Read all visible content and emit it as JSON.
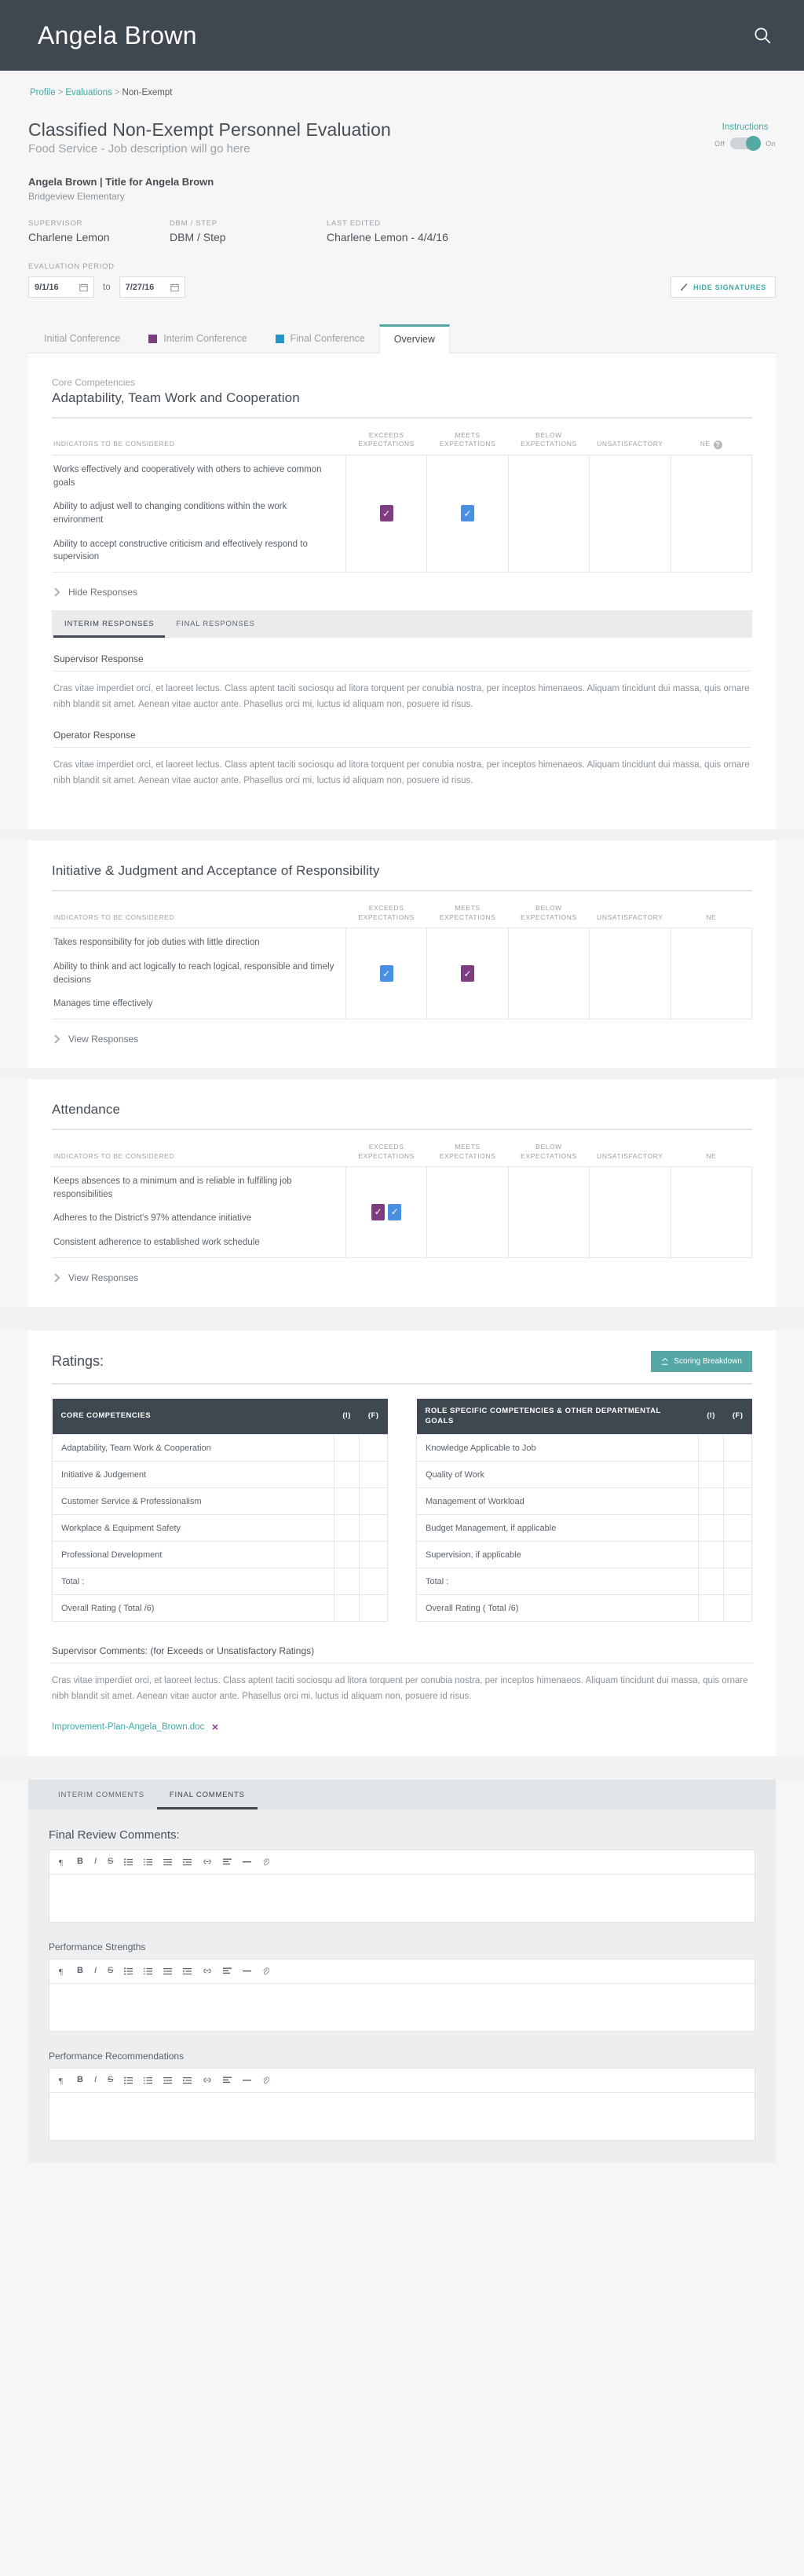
{
  "topbar": {
    "title": "Angela Brown",
    "search_icon": "search-icon"
  },
  "breadcrumb": {
    "profile": "Profile",
    "evaluations": "Evaluations",
    "current": "Non-Exempt",
    "sep": ">"
  },
  "header": {
    "title": "Classified Non-Exempt Personnel Evaluation",
    "subtitle": "Food Service - Job description will go here",
    "instructions_label": "Instructions",
    "toggle_off": "Off",
    "toggle_on": "On",
    "toggle_state": "on"
  },
  "employee": {
    "name_title": "Angela Brown | Title for Angela Brown",
    "school": "Bridgeview Elementary"
  },
  "meta": [
    {
      "label": "SUPERVISOR",
      "value": "Charlene Lemon"
    },
    {
      "label": "DBM / STEP",
      "value": "DBM / Step"
    },
    {
      "label": "LAST EDITED",
      "value": "Charlene Lemon - 4/4/16"
    }
  ],
  "period": {
    "label": "EVALUATION PERIOD",
    "start": "9/1/16",
    "end": "7/27/16",
    "to": "to",
    "hide_signatures": "HIDE SIGNATURES"
  },
  "conference_tabs": [
    {
      "label": "Initial Conference",
      "marker": "none",
      "active": false
    },
    {
      "label": "Interim Conference",
      "marker": "#7d3d80",
      "active": false
    },
    {
      "label": "Final Conference",
      "marker": "#2196c9",
      "active": false
    },
    {
      "label": "Overview",
      "marker": "none",
      "active": true
    }
  ],
  "table_headers": {
    "indicators": "INDICATORS TO BE CONSIDERED",
    "exceeds": "EXCEEDS EXPECTATIONS",
    "meets": "MEETS EXPECTATIONS",
    "below": "BELOW EXPECTATIONS",
    "unsatisfactory": "UNSATISFACTORY",
    "ne": "NE"
  },
  "sections": [
    {
      "kicker": "Core Competencies",
      "title": "Adaptability, Team Work and Cooperation",
      "has_help_icon": true,
      "indicators": [
        "Works effectively and cooperatively with others to achieve common goals",
        "Ability to adjust well to changing conditions within the work environment",
        "Ability to accept constructive criticism and effectively respond to supervision"
      ],
      "marks": {
        "exceeds": [
          "purple"
        ],
        "meets": [
          "blue"
        ],
        "below": [],
        "unsatisfactory": [],
        "ne": []
      },
      "responses_toggle": "Hide Responses",
      "responses_expanded": true,
      "response_tabs": [
        {
          "label": "INTERIM RESPONSES",
          "active": true
        },
        {
          "label": "FINAL RESPONSES",
          "active": false
        }
      ],
      "responses": [
        {
          "heading": "Supervisor Response",
          "text": "Cras vitae imperdiet orci, et laoreet lectus. Class aptent taciti sociosqu ad litora torquent per conubia nostra, per inceptos himenaeos. Aliquam tincidunt dui massa, quis ornare nibh blandit sit amet. Aenean vitae auctor ante. Phasellus orci mi, luctus id aliquam non, posuere id risus."
        },
        {
          "heading": "Operator Response",
          "text": "Cras vitae imperdiet orci, et laoreet lectus. Class aptent taciti sociosqu ad litora torquent per conubia nostra, per inceptos himenaeos. Aliquam tincidunt dui massa, quis ornare nibh blandit sit amet. Aenean vitae auctor ante. Phasellus orci mi, luctus id aliquam non, posuere id risus."
        }
      ]
    },
    {
      "kicker": "",
      "title": "Initiative & Judgment  and Acceptance of Responsibility",
      "has_help_icon": false,
      "indicators": [
        "Takes responsibility for job duties with little direction",
        "Ability to think and act logically to reach logical, responsible and timely decisions",
        "Manages time effectively"
      ],
      "marks": {
        "exceeds": [
          "blue"
        ],
        "meets": [
          "purple"
        ],
        "below": [],
        "unsatisfactory": [],
        "ne": []
      },
      "responses_toggle": "View Responses",
      "responses_expanded": false,
      "response_tabs": [],
      "responses": []
    },
    {
      "kicker": "",
      "title": "Attendance",
      "has_help_icon": false,
      "indicators": [
        "Keeps absences to a minimum and is reliable in fulfilling job responsibilities",
        "Adheres to the District's 97% attendance initiative",
        "Consistent adherence to established work schedule"
      ],
      "marks": {
        "exceeds": [
          "purple",
          "blue"
        ],
        "meets": [],
        "below": [],
        "unsatisfactory": [],
        "ne": []
      },
      "responses_toggle": "View Responses",
      "responses_expanded": false,
      "response_tabs": [],
      "responses": []
    }
  ],
  "ratings": {
    "title": "Ratings:",
    "scoring_button": "Scoring Breakdown",
    "col_i": "(I)",
    "col_f": "(F)",
    "left_table": {
      "header": "CORE COMPETENCIES",
      "rows": [
        "Adaptability, Team Work & Cooperation",
        "Initiative & Judgement",
        "Customer Service & Professionalism",
        "Workplace & Equipment Safety",
        "Professional Development",
        "Total :",
        "Overall  Rating ( Total /6)"
      ]
    },
    "right_table": {
      "header": "ROLE SPECIFIC COMPETENCIES & OTHER DEPARTMENTAL GOALS",
      "rows": [
        "Knowledge Applicable to Job",
        "Quality of Work",
        "Management of Workload",
        "Budget Management, if applicable",
        "Supervision, if applicable",
        "Total :",
        "Overall  Rating ( Total /6)"
      ]
    },
    "supervisor_comments_title": "Supervisor Comments: (for Exceeds or Unsatisfactory Ratings)",
    "supervisor_comments_text": "Cras vitae imperdiet orci, et laoreet lectus. Class aptent taciti sociosqu ad litora torquent per conubia nostra, per inceptos himenaeos. Aliquam tincidunt dui massa, quis ornare nibh blandit sit amet. Aenean vitae auctor ante. Phasellus orci mi, luctus id aliquam non, posuere id risus.",
    "attachment": "Improvement-Plan-Angela_Brown.doc",
    "attachment_remove": "✕"
  },
  "comments_panel": {
    "tabs": [
      {
        "label": "INTERIM COMMENTS",
        "active": false
      },
      {
        "label": "FINAL COMMENTS",
        "active": true
      }
    ],
    "final_review_title": "Final Review Comments:",
    "performance_strengths_title": "Performance Strengths",
    "performance_recommendations_title": "Performance Recommendations",
    "toolbar_icons": [
      "paragraph-icon",
      "bold-icon",
      "italic-icon",
      "strikethrough-icon",
      "bullet-list-icon",
      "numbered-list-icon",
      "outdent-icon",
      "indent-icon",
      "link-icon",
      "align-icon",
      "horizontal-rule-icon",
      "attachment-icon"
    ],
    "toolbar_glyphs": [
      "¶",
      "B",
      "I",
      "S",
      "☰",
      "☷",
      "⇤",
      "⇥",
      "∞",
      "≡",
      "—",
      "📎"
    ]
  },
  "colors": {
    "accent_teal": "#56a8a4",
    "purple": "#7d3d80",
    "blue": "#4a90e2",
    "dark": "#3f4750"
  }
}
